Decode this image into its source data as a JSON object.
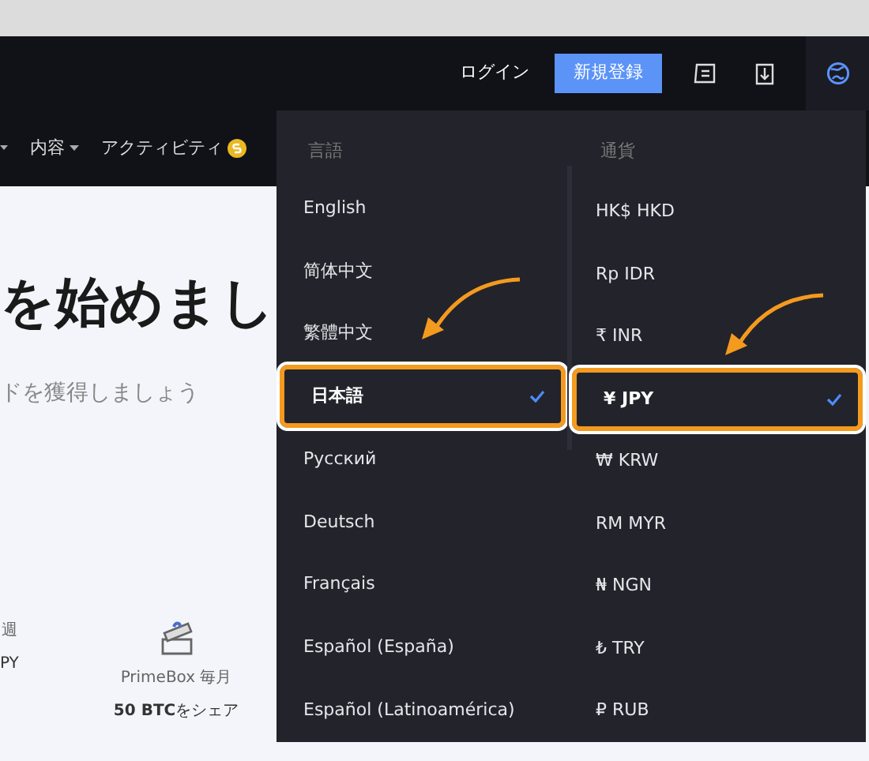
{
  "header": {
    "login": "ログイン",
    "signup": "新規登録"
  },
  "nav": [
    {
      "kind": "caret"
    },
    {
      "kind": "dropdown",
      "label": "内容"
    },
    {
      "kind": "badge",
      "label": "アクティビティ"
    }
  ],
  "hero": {
    "title": "を始めまし",
    "subtitle": "ドを獲得しましょう"
  },
  "features": [
    {
      "kind": "text",
      "line1": "週",
      "line2": "PY"
    },
    {
      "kind": "box",
      "line1": "PrimeBox 毎月",
      "line2": "**50 BTC**をシェア"
    }
  ],
  "menu": {
    "language_heading": "言語",
    "currency_heading": "通貨",
    "languages": [
      {
        "label": "English",
        "selected": false
      },
      {
        "label": "简体中文",
        "selected": false
      },
      {
        "label": "繁體中文",
        "selected": false
      },
      {
        "label": "日本語",
        "selected": true
      },
      {
        "label": "Русский",
        "selected": false
      },
      {
        "label": "Deutsch",
        "selected": false
      },
      {
        "label": "Français",
        "selected": false
      },
      {
        "label": "Español (España)",
        "selected": false
      },
      {
        "label": "Español (Latinoamérica)",
        "selected": false
      }
    ],
    "currencies": [
      {
        "label": "HK$ HKD",
        "selected": false
      },
      {
        "label": "Rp IDR",
        "selected": false
      },
      {
        "label": "₹ INR",
        "selected": false
      },
      {
        "label": "¥ JPY",
        "selected": true
      },
      {
        "label": "₩ KRW",
        "selected": false
      },
      {
        "label": "RM MYR",
        "selected": false
      },
      {
        "label": "₦ NGN",
        "selected": false
      },
      {
        "label": "₺ TRY",
        "selected": false
      },
      {
        "label": "₽ RUB",
        "selected": false
      }
    ]
  }
}
